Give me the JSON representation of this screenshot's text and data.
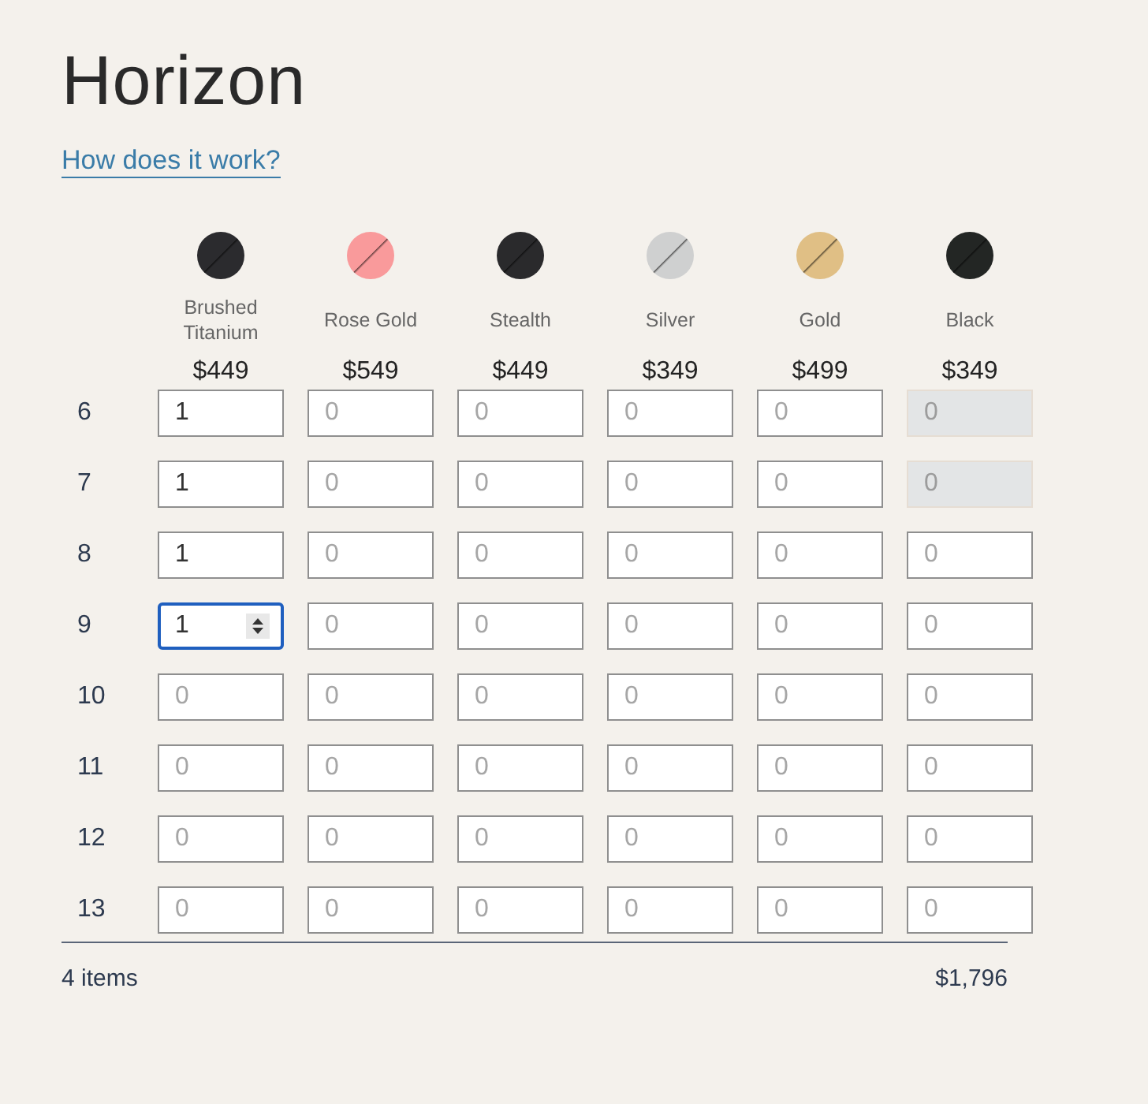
{
  "title": "Horizon",
  "help_link": "How does it work?",
  "finishes": [
    {
      "name": "Brushed Titanium",
      "price": "$449",
      "color": "#2b2b2e"
    },
    {
      "name": "Rose Gold",
      "price": "$549",
      "color": "#f99a9b"
    },
    {
      "name": "Stealth",
      "price": "$449",
      "color": "#2a2a2c"
    },
    {
      "name": "Silver",
      "price": "$349",
      "color": "#cfd0d0"
    },
    {
      "name": "Gold",
      "price": "$499",
      "color": "#e0bf85"
    },
    {
      "name": "Black",
      "price": "$349",
      "color": "#232624"
    }
  ],
  "rows": [
    {
      "size": "6",
      "cells": [
        {
          "value": "1",
          "disabled": false,
          "focused": false
        },
        {
          "placeholder": "0",
          "disabled": false,
          "focused": false
        },
        {
          "placeholder": "0",
          "disabled": false,
          "focused": false
        },
        {
          "placeholder": "0",
          "disabled": false,
          "focused": false
        },
        {
          "placeholder": "0",
          "disabled": false,
          "focused": false
        },
        {
          "placeholder": "0",
          "disabled": true,
          "focused": false
        }
      ]
    },
    {
      "size": "7",
      "cells": [
        {
          "value": "1",
          "disabled": false,
          "focused": false
        },
        {
          "placeholder": "0",
          "disabled": false,
          "focused": false
        },
        {
          "placeholder": "0",
          "disabled": false,
          "focused": false
        },
        {
          "placeholder": "0",
          "disabled": false,
          "focused": false
        },
        {
          "placeholder": "0",
          "disabled": false,
          "focused": false
        },
        {
          "placeholder": "0",
          "disabled": true,
          "focused": false
        }
      ]
    },
    {
      "size": "8",
      "cells": [
        {
          "value": "1",
          "disabled": false,
          "focused": false
        },
        {
          "placeholder": "0",
          "disabled": false,
          "focused": false
        },
        {
          "placeholder": "0",
          "disabled": false,
          "focused": false
        },
        {
          "placeholder": "0",
          "disabled": false,
          "focused": false
        },
        {
          "placeholder": "0",
          "disabled": false,
          "focused": false
        },
        {
          "placeholder": "0",
          "disabled": false,
          "focused": false
        }
      ]
    },
    {
      "size": "9",
      "cells": [
        {
          "value": "1",
          "disabled": false,
          "focused": true
        },
        {
          "placeholder": "0",
          "disabled": false,
          "focused": false
        },
        {
          "placeholder": "0",
          "disabled": false,
          "focused": false
        },
        {
          "placeholder": "0",
          "disabled": false,
          "focused": false
        },
        {
          "placeholder": "0",
          "disabled": false,
          "focused": false
        },
        {
          "placeholder": "0",
          "disabled": false,
          "focused": false
        }
      ]
    },
    {
      "size": "10",
      "cells": [
        {
          "placeholder": "0",
          "disabled": false,
          "focused": false
        },
        {
          "placeholder": "0",
          "disabled": false,
          "focused": false
        },
        {
          "placeholder": "0",
          "disabled": false,
          "focused": false
        },
        {
          "placeholder": "0",
          "disabled": false,
          "focused": false
        },
        {
          "placeholder": "0",
          "disabled": false,
          "focused": false
        },
        {
          "placeholder": "0",
          "disabled": false,
          "focused": false
        }
      ]
    },
    {
      "size": "11",
      "cells": [
        {
          "placeholder": "0",
          "disabled": false,
          "focused": false
        },
        {
          "placeholder": "0",
          "disabled": false,
          "focused": false
        },
        {
          "placeholder": "0",
          "disabled": false,
          "focused": false
        },
        {
          "placeholder": "0",
          "disabled": false,
          "focused": false
        },
        {
          "placeholder": "0",
          "disabled": false,
          "focused": false
        },
        {
          "placeholder": "0",
          "disabled": false,
          "focused": false
        }
      ]
    },
    {
      "size": "12",
      "cells": [
        {
          "placeholder": "0",
          "disabled": false,
          "focused": false
        },
        {
          "placeholder": "0",
          "disabled": false,
          "focused": false
        },
        {
          "placeholder": "0",
          "disabled": false,
          "focused": false
        },
        {
          "placeholder": "0",
          "disabled": false,
          "focused": false
        },
        {
          "placeholder": "0",
          "disabled": false,
          "focused": false
        },
        {
          "placeholder": "0",
          "disabled": false,
          "focused": false
        }
      ]
    },
    {
      "size": "13",
      "cells": [
        {
          "placeholder": "0",
          "disabled": false,
          "focused": false
        },
        {
          "placeholder": "0",
          "disabled": false,
          "focused": false
        },
        {
          "placeholder": "0",
          "disabled": false,
          "focused": false
        },
        {
          "placeholder": "0",
          "disabled": false,
          "focused": false
        },
        {
          "placeholder": "0",
          "disabled": false,
          "focused": false
        },
        {
          "placeholder": "0",
          "disabled": false,
          "focused": false
        }
      ]
    }
  ],
  "footer": {
    "count": "4 items",
    "total": "$1,796"
  }
}
